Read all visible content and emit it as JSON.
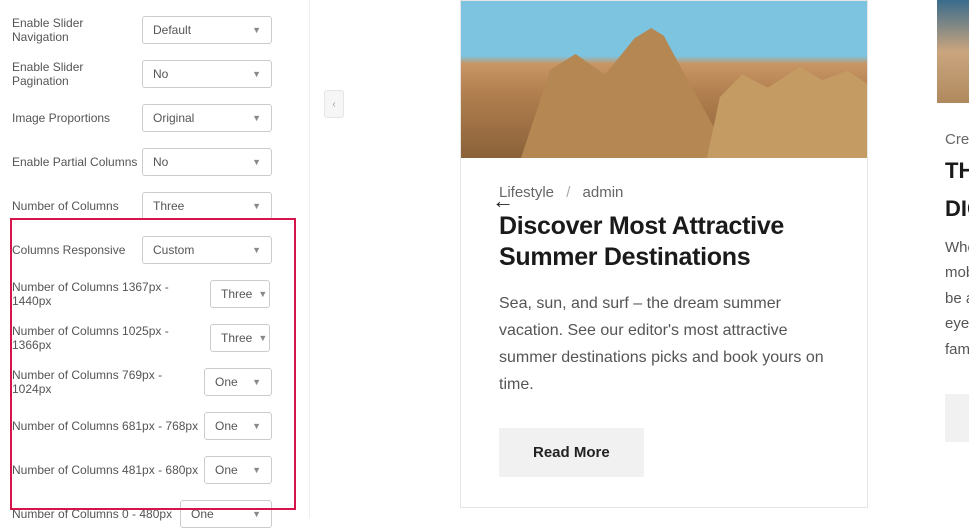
{
  "settings": {
    "enable_slider_navigation": {
      "label": "Enable Slider Navigation",
      "value": "Default"
    },
    "enable_slider_pagination": {
      "label": "Enable Slider Pagination",
      "value": "No"
    },
    "image_proportions": {
      "label": "Image Proportions",
      "value": "Original"
    },
    "enable_partial_columns": {
      "label": "Enable Partial Columns",
      "value": "No"
    },
    "number_of_columns": {
      "label": "Number of Columns",
      "value": "Three"
    },
    "columns_responsive": {
      "label": "Columns Responsive",
      "value": "Custom"
    },
    "cols_1367_1440": {
      "label": "Number of Columns 1367px - 1440px",
      "value": "Three"
    },
    "cols_1025_1366": {
      "label": "Number of Columns 1025px - 1366px",
      "value": "Three"
    },
    "cols_769_1024": {
      "label": "Number of Columns 769px - 1024px",
      "value": "One"
    },
    "cols_681_768": {
      "label": "Number of Columns 681px - 768px",
      "value": "One"
    },
    "cols_481_680": {
      "label": "Number of Columns 481px - 680px",
      "value": "One"
    },
    "cols_0_480": {
      "label": "Number of Columns 0 - 480px",
      "value": "One"
    }
  },
  "preview": {
    "card1": {
      "category": "Lifestyle",
      "separator": "/",
      "author": "admin",
      "title": "Discover Most Attractive Summer Destinations",
      "excerpt": "Sea, sun, and surf – the dream summer vacation. See our editor's most attractive summer destinations picks and book yours on time.",
      "button": "Read More"
    },
    "card2": {
      "category": "Crea",
      "title_line1": "THE",
      "title_line2": "DIG",
      "excerpt_lines": [
        "Whe",
        "mob",
        "be a",
        "eye",
        "fam"
      ]
    },
    "prev_arrow": "←",
    "collapse_icon": "‹"
  }
}
